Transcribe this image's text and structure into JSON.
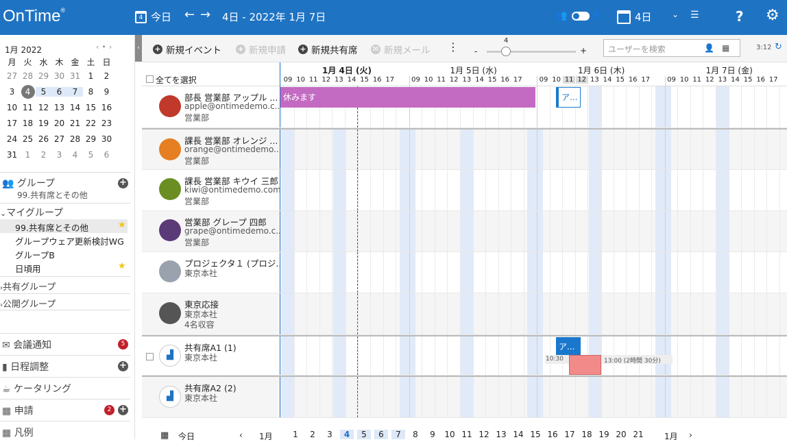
{
  "app": {
    "logo": "OnTime",
    "reg": "®"
  },
  "topbar": {
    "today_label": "今日",
    "range_label": "4日 - 2022年 1月 7日",
    "days_label": "4日",
    "cal_day": "4",
    "help": "?"
  },
  "calendar": {
    "month_label": "1月 2022",
    "weekdays": [
      "月",
      "火",
      "水",
      "木",
      "金",
      "土",
      "日"
    ],
    "weeks": [
      [
        "27",
        "28",
        "29",
        "30",
        "31",
        "1",
        "2"
      ],
      [
        "3",
        "4",
        "5",
        "6",
        "7",
        "8",
        "9"
      ],
      [
        "10",
        "11",
        "12",
        "13",
        "14",
        "15",
        "16"
      ],
      [
        "17",
        "18",
        "19",
        "20",
        "21",
        "22",
        "23"
      ],
      [
        "24",
        "25",
        "26",
        "27",
        "28",
        "29",
        "30"
      ],
      [
        "31",
        "1",
        "2",
        "3",
        "4",
        "5",
        "6"
      ]
    ]
  },
  "sidebar": {
    "group_title": "グループ",
    "group_sub": "99.共有席とその他",
    "my_group": "マイグループ",
    "my_items": [
      "99.共有席とその他",
      "グループウェア更新検討WG",
      "グループB",
      "日頃用"
    ],
    "shared_group": "共有グループ",
    "public_group": "公開グループ",
    "meeting": "会議通知",
    "meeting_count": "5",
    "schedule": "日程調整",
    "catering": "ケータリング",
    "apply": "申請",
    "apply_count": "2",
    "legend": "凡例"
  },
  "toolbar": {
    "new_event": "新規イベント",
    "new_apply": "新規申請",
    "new_shared": "新規共有席",
    "new_mail": "新規メール",
    "zoom_value": "4",
    "minus": "-",
    "plus": "+",
    "search_placeholder": "ユーザーを検索",
    "time": "3:12"
  },
  "grid": {
    "select_all": "全てを選択",
    "days": [
      "1月 4日 (火)",
      "1月 5日 (水)",
      "1月 6日 (木)",
      "1月 7日 (金)"
    ],
    "hours": [
      "09",
      "10",
      "11",
      "12",
      "13",
      "14",
      "15",
      "16",
      "17"
    ]
  },
  "rows": [
    {
      "name": "部長 営業部 アップル ...",
      "email": "apple@ontimedemo.c...",
      "dept": "営業部",
      "avatar": "#c0392b"
    },
    {
      "name": "課長 営業部 オレンジ ...",
      "email": "orange@ontimedemo....",
      "dept": "営業部",
      "avatar": "#e67e22"
    },
    {
      "name": "課長 営業部 キウイ 三郎",
      "email": "kiwi@ontimedemo.com",
      "dept": "営業部",
      "avatar": "#6b8e23"
    },
    {
      "name": "営業部 グレープ 四郎",
      "email": "grape@ontimedemo.c...",
      "dept": "営業部",
      "avatar": "#5b3a78"
    },
    {
      "name": "プロジェクタ１ (プロジ...",
      "email": "東京本社",
      "dept": "",
      "avatar": "#9aa3ad"
    },
    {
      "name": "東京応接",
      "email": "東京本社",
      "dept": "4名収容",
      "avatar": "#555"
    },
    {
      "name": "共有席A1 (1)",
      "email": "東京本社",
      "dept": "",
      "avatar": "#ffffff"
    },
    {
      "name": "共有席A2 (2)",
      "email": "東京本社",
      "dept": "",
      "avatar": "#ffffff"
    }
  ],
  "events": {
    "holiday": "休みます",
    "short_a1": "ア...",
    "short_a2": "ア...",
    "t_start": "10:30",
    "t_end": "13:00 (2時間 30分)"
  },
  "bottom": {
    "today": "今日",
    "month_left": "1月",
    "month_right": "1月",
    "days": [
      "1",
      "2",
      "3",
      "4",
      "5",
      "6",
      "7",
      "8",
      "9",
      "10",
      "11",
      "12",
      "13",
      "14",
      "15",
      "16",
      "17",
      "18",
      "19",
      "20",
      "21"
    ]
  },
  "colors": {
    "brand": "#1f73c3",
    "holiday": "#c36bc3",
    "event": "#1a78cc",
    "busy": "#f28a8a",
    "today_line": "#c0202a"
  }
}
